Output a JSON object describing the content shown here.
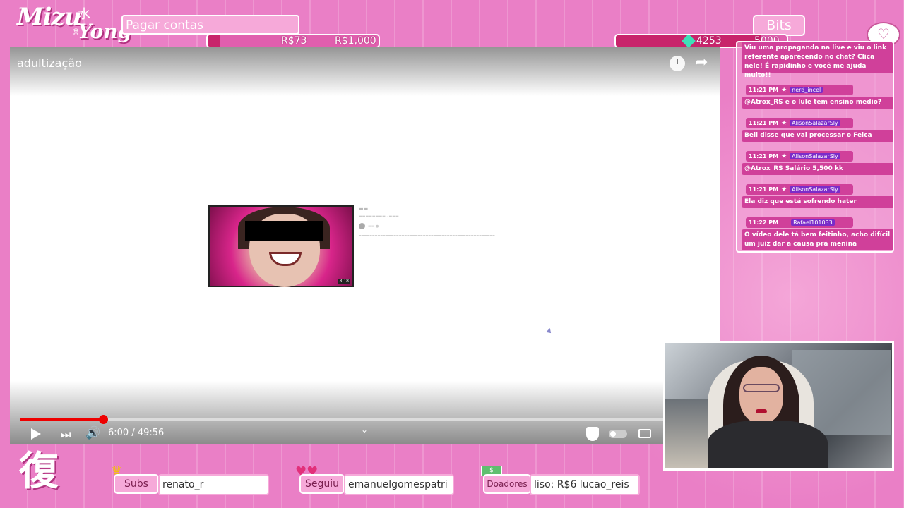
{
  "logo": {
    "word1": "Mizu",
    "word2": "Yong",
    "kanji_top": "水",
    "kanji_side": "용"
  },
  "goal": {
    "title": "Pagar contas",
    "current": "R$73",
    "target": "R$1,000",
    "progress_fraction": 0.073
  },
  "bits": {
    "label": "Bits",
    "current": "4253",
    "target": "5000",
    "progress_fraction": 0.85
  },
  "chat": {
    "partial_message": "Viu uma propaganda na live e viu o link referente aparecendo no chat? Clica nele! É rapidinho e você me ajuda muito!!",
    "messages": [
      {
        "time": "11:21 PM",
        "user": "nerd_incel",
        "star": true,
        "text": "@Atrox_RS e o lule tem ensino medio?"
      },
      {
        "time": "11:21 PM",
        "user": "AlisonSalazarSly",
        "star": true,
        "text": "Bell disse que vai processar o Felca"
      },
      {
        "time": "11:21 PM",
        "user": "AlisonSalazarSly",
        "star": true,
        "text": "@Atrox_RS Salário 5,500 kk"
      },
      {
        "time": "11:21 PM",
        "user": "AlisonSalazarSly",
        "star": true,
        "text": "Ela diz que está sofrendo hater"
      },
      {
        "time": "11:22 PM",
        "user": "Rafael101033",
        "star": false,
        "text": "O vídeo dele tá bem feitinho, acho difícil um juiz dar a causa pra menina"
      }
    ]
  },
  "video": {
    "title": "adultização",
    "current_time": "6:00",
    "duration": "49:56",
    "time_display": "6:00 / 49:56",
    "progress_fraction": 0.12,
    "thumb_duration": "8:18",
    "colors": {
      "progress": "#ee0000"
    }
  },
  "bottom": {
    "kanji": "復",
    "subs": {
      "label": "Subs",
      "value": "renato_r"
    },
    "follow": {
      "label": "Seguiu",
      "value": "emanuelgomespatri"
    },
    "donors": {
      "label": "Doadores",
      "value": "liso: R$6    lucao_reis"
    }
  },
  "colors": {
    "accent": "#d0409a",
    "background": "#ea7fc6",
    "panel": "#f6a9d9"
  }
}
